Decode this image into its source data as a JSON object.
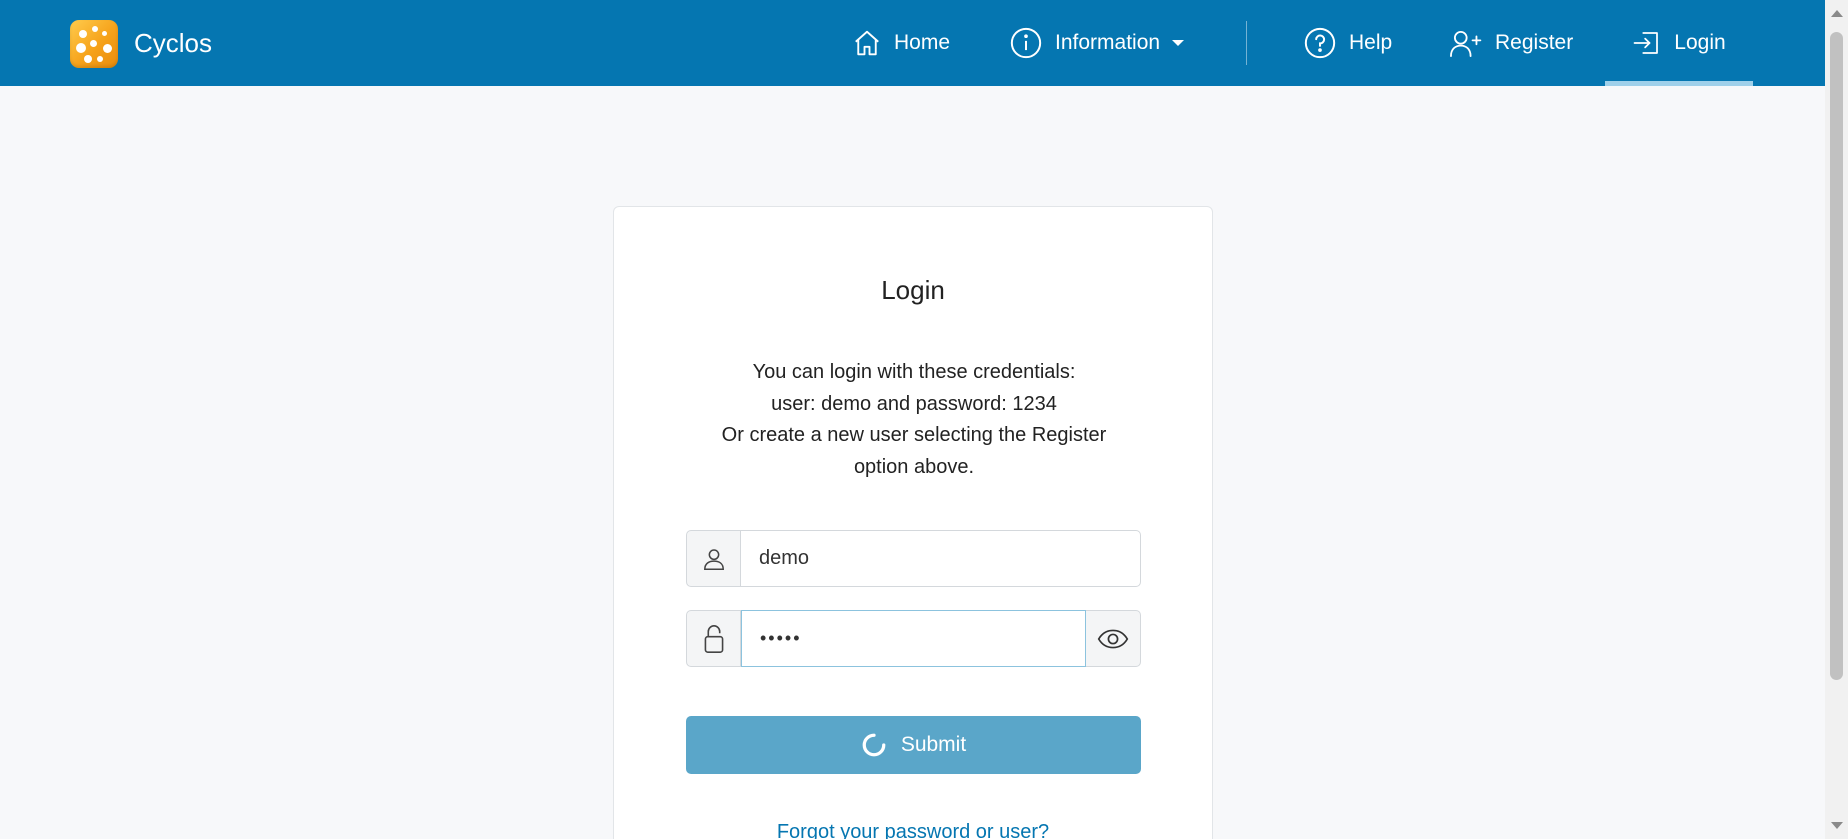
{
  "brand": {
    "name": "Cyclos"
  },
  "nav": {
    "home_label": "Home",
    "information_label": "Information",
    "help_label": "Help",
    "register_label": "Register",
    "login_label": "Login",
    "active_item": "Login"
  },
  "login": {
    "title": "Login",
    "info_lines": [
      "You can login with these credentials:",
      "user: demo and password: 1234",
      "Or create a new user selecting the Register",
      "option above."
    ],
    "username_value": "demo",
    "password_value": "•••••",
    "submit_label": "Submit",
    "submit_state": "loading",
    "forgot_link": "Forgot your password or user?"
  },
  "colors": {
    "topbar": "#0576b1",
    "active_indicator": "#9fd0ea",
    "submit_button": "#5aa6c9",
    "link": "#0576b1",
    "page_background": "#f7f8fa"
  },
  "icons": {
    "brand": "cyclos-logo-icon",
    "home": "home-icon",
    "information": "info-circle-icon",
    "help": "question-circle-icon",
    "register": "person-add-icon",
    "login": "box-arrow-in-right-icon",
    "username": "person-icon",
    "password": "lock-icon",
    "toggle_password": "eye-icon",
    "submit_spinner": "spinner-icon"
  }
}
